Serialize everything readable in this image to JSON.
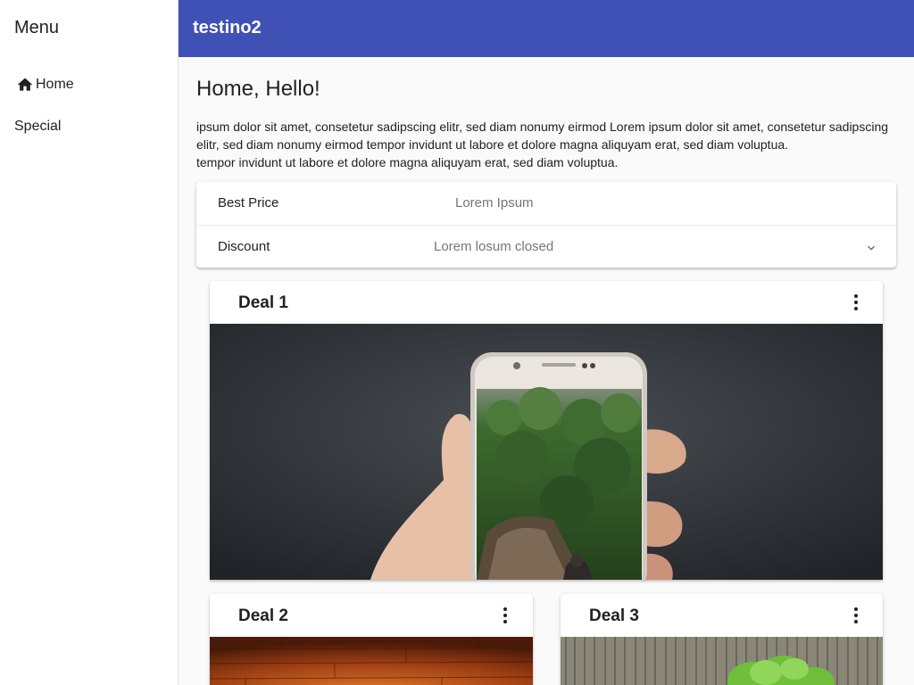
{
  "sidebar": {
    "title": "Menu",
    "items": [
      {
        "label": "Home",
        "icon": "home-icon"
      },
      {
        "label": "Special"
      }
    ]
  },
  "toolbar": {
    "title": "testino2",
    "color": "#3f51b5"
  },
  "main": {
    "title": "Home, Hello!",
    "intro_lines": [
      "ipsum dolor sit amet, consetetur sadipscing elitr, sed diam nonumy eirmod Lorem ipsum dolor sit amet, consetetur sadipscing elitr, sed diam nonumy eirmod tempor invidunt ut labore et dolore magna aliquyam erat, sed diam voluptua.",
      "tempor invidunt ut labore et dolore magna aliquyam erat, sed diam voluptua."
    ],
    "panels": [
      {
        "label": "Best Price",
        "description": "Lorem Ipsum"
      },
      {
        "label": "Discount",
        "description": "Lorem losum closed",
        "icon": "chevron-down-icon"
      }
    ],
    "cards": [
      {
        "title": "Deal 1",
        "menu_icon": "more-vert-icon",
        "image": "hand holding smartphone showing forest and railway"
      },
      {
        "title": "Deal 2",
        "menu_icon": "more-vert-icon",
        "image": "wooden planks"
      },
      {
        "title": "Deal 3",
        "menu_icon": "more-vert-icon",
        "image": "lettuce in front of bamboo fence"
      }
    ]
  }
}
